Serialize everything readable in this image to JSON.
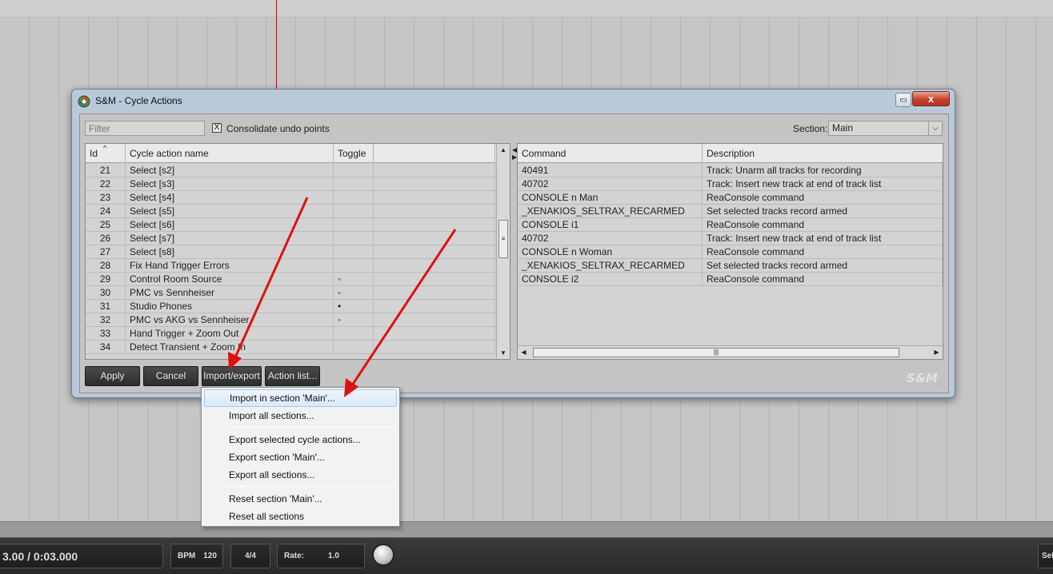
{
  "window": {
    "title": "S&M - Cycle Actions",
    "close_glyph": "x",
    "restore_glyph": "▭"
  },
  "toolbar": {
    "filter_placeholder": "Filter",
    "consolidate_label": "Consolidate undo points",
    "consolidate_checked": true,
    "section_label": "Section:",
    "section_value": "Main"
  },
  "actions_table": {
    "columns": [
      "Id",
      "Cycle action name",
      "Toggle"
    ],
    "rows": [
      {
        "id": "21",
        "name": "Select [s2]",
        "toggle": ""
      },
      {
        "id": "22",
        "name": "Select [s3]",
        "toggle": ""
      },
      {
        "id": "23",
        "name": "Select [s4]",
        "toggle": ""
      },
      {
        "id": "24",
        "name": "Select [s5]",
        "toggle": ""
      },
      {
        "id": "25",
        "name": "Select [s6]",
        "toggle": ""
      },
      {
        "id": "26",
        "name": "Select [s7]",
        "toggle": ""
      },
      {
        "id": "27",
        "name": "Select [s8]",
        "toggle": ""
      },
      {
        "id": "28",
        "name": "Fix Hand Trigger Errors",
        "toggle": ""
      },
      {
        "id": "29",
        "name": "Control Room Source",
        "toggle": "◦"
      },
      {
        "id": "30",
        "name": "PMC vs Sennheiser",
        "toggle": "◦"
      },
      {
        "id": "31",
        "name": "Studio Phones",
        "toggle": "•"
      },
      {
        "id": "32",
        "name": "PMC vs AKG vs Sennheiser",
        "toggle": "◦"
      },
      {
        "id": "33",
        "name": "Hand Trigger + Zoom Out",
        "toggle": ""
      },
      {
        "id": "34",
        "name": "Detect Transient + Zoom In",
        "toggle": ""
      }
    ]
  },
  "commands_table": {
    "columns": [
      "Command",
      "Description"
    ],
    "rows": [
      {
        "command": "40491",
        "description": "Track: Unarm all tracks for recording"
      },
      {
        "command": "40702",
        "description": "Track: Insert new track at end of track list"
      },
      {
        "command": "CONSOLE n Man",
        "description": "ReaConsole command"
      },
      {
        "command": "_XENAKIOS_SELTRAX_RECARMED",
        "description": "Set selected tracks record armed"
      },
      {
        "command": "CONSOLE i1",
        "description": "ReaConsole command"
      },
      {
        "command": "40702",
        "description": "Track: Insert new track at end of track list"
      },
      {
        "command": "CONSOLE n Woman",
        "description": "ReaConsole command"
      },
      {
        "command": "_XENAKIOS_SELTRAX_RECARMED",
        "description": "Set selected tracks record armed"
      },
      {
        "command": "CONSOLE i2",
        "description": "ReaConsole command"
      }
    ]
  },
  "buttons": {
    "apply": "Apply",
    "cancel": "Cancel",
    "import_export": "Import/export",
    "action_list": "Action list..."
  },
  "watermark": "S&M",
  "context_menu": {
    "items": [
      "Import in section 'Main'...",
      "Import all sections...",
      "Export selected cycle actions...",
      "Export section 'Main'...",
      "Export all sections...",
      "Reset section 'Main'...",
      "Reset all sections"
    ],
    "highlighted_index": 0
  },
  "transport": {
    "time": "3.00 / 0:03.000",
    "bpm_label": "BPM",
    "bpm_value": "120",
    "time_signature": "4/4",
    "rate_label": "Rate:",
    "rate_value": "1.0",
    "sel_label": "Sel"
  },
  "colors": {
    "annotation_arrow": "#e01010",
    "close_button": "#c7412c",
    "menu_highlight": "#dbe9f9"
  }
}
